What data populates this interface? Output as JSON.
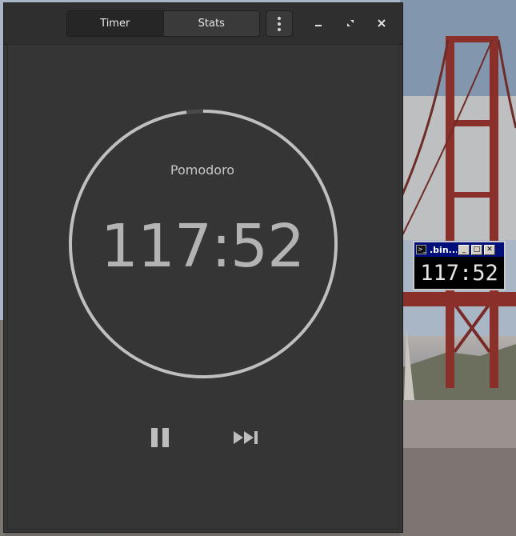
{
  "app": {
    "tabs": [
      {
        "label": "Timer",
        "active": true
      },
      {
        "label": "Stats",
        "active": false
      }
    ],
    "icons": {
      "menu": "more-vertical-icon",
      "minimize": "minimize-icon",
      "maximize": "maximize-icon",
      "close": "close-icon"
    },
    "timer": {
      "mode": "Pomodoro",
      "time": "117:52",
      "progress_fraction": 0.02
    },
    "controls": {
      "pause": "pause-icon",
      "skip": "skip-forward-icon"
    },
    "colors": {
      "window_bg": "#353535",
      "ring": "#bfbfbf",
      "ring_elapsed": "#4a4a4a",
      "text": "#b3b3b3"
    }
  },
  "terminal": {
    "title": ".bin...",
    "time": "117:52",
    "title_bar_color": "#000f7a"
  }
}
